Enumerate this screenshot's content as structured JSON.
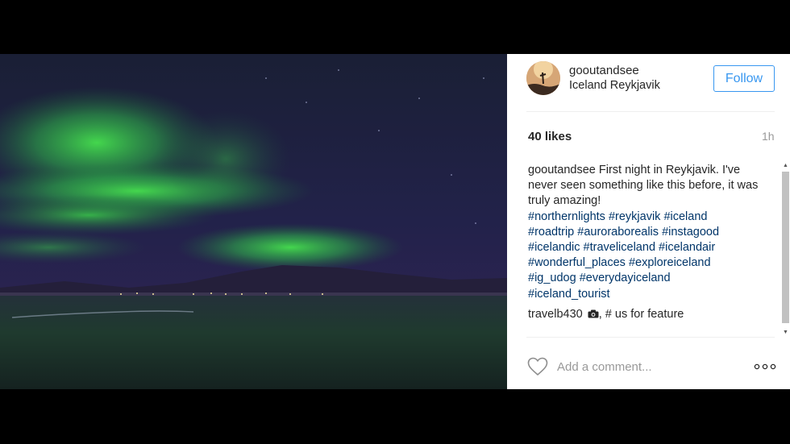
{
  "post": {
    "username": "gooutandsee",
    "location": "Iceland Reykjavik",
    "follow_label": "Follow",
    "likes": "40 likes",
    "time": "1h"
  },
  "caption": {
    "user": "gooutandsee",
    "text": "First night in Reykjavik. I've never seen something like this before, it was truly amazing!",
    "hashtags": [
      "#northernlights",
      "#reykjavik",
      "#iceland",
      "#roadtrip",
      "#auroraborealis",
      "#instagood",
      "#icelandic",
      "#traveliceland",
      "#icelandair",
      "#wonderful_places",
      "#exploreiceland",
      "#ig_udog",
      "#everydayiceland",
      "#iceland_tourist"
    ]
  },
  "comment2": {
    "user": "travelb430",
    "icon": "camera-icon",
    "text": ", # us for feature"
  },
  "footer": {
    "comment_placeholder": "Add a comment...",
    "heart_icon": "heart-icon",
    "more_icon": "more-options-icon"
  },
  "colors": {
    "follow_blue": "#3897f0",
    "hashtag": "#003569",
    "aurora_green": "#3fd84a",
    "sky": "#1d1e3e"
  }
}
